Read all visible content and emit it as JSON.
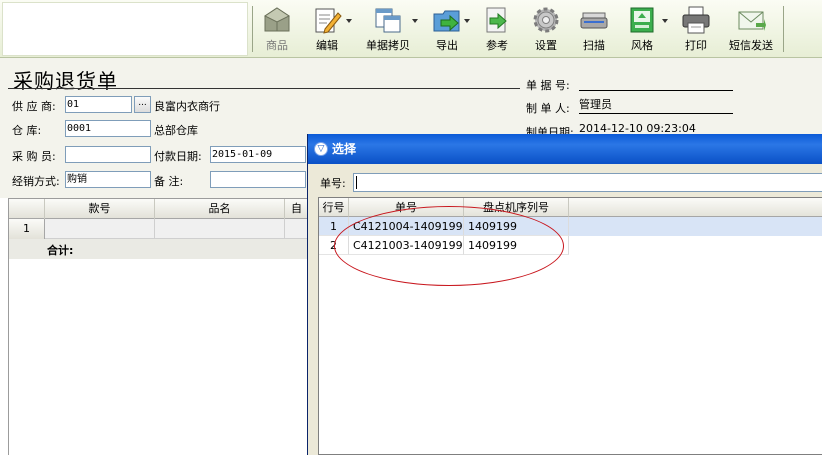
{
  "toolbar": {
    "buttons": [
      {
        "label": "商品",
        "icon": "goods-icon"
      },
      {
        "label": "编辑",
        "icon": "edit-icon"
      },
      {
        "label": "单据拷贝",
        "icon": "copy-doc-icon"
      },
      {
        "label": "导出",
        "icon": "export-icon"
      },
      {
        "label": "参考",
        "icon": "reference-icon"
      },
      {
        "label": "设置",
        "icon": "settings-gear-icon"
      },
      {
        "label": "扫描",
        "icon": "scanner-icon"
      },
      {
        "label": "风格",
        "icon": "style-icon"
      },
      {
        "label": "打印",
        "icon": "printer-icon"
      },
      {
        "label": "短信发送",
        "icon": "sms-envelope-icon"
      }
    ]
  },
  "form": {
    "title": "采购退货单",
    "supplier_label": "供 应 商:",
    "supplier_code": "01",
    "supplier_name": "良富内衣商行",
    "browse_label": "...",
    "warehouse_label": "仓    库:",
    "warehouse_code": "0001",
    "warehouse_name": "总部仓库",
    "purchaser_label": "采 购 员:",
    "purchaser_value": "",
    "payment_date_label": "付款日期:",
    "payment_date": "2015-01-09",
    "sales_mode_label": "经销方式:",
    "sales_mode": "购销",
    "remark_label": "备    注:",
    "remark_value": "",
    "doc_no_label": "单 据 号:",
    "doc_no": "",
    "maker_label": "制 单 人:",
    "maker": "管理员",
    "make_date_label": "制单日期:",
    "make_date": "2014-12-10 09:23:04"
  },
  "grid": {
    "columns": [
      "款号",
      "品名",
      "自"
    ],
    "rows": [
      {
        "num": "1"
      }
    ],
    "total_label": "合计:"
  },
  "dialog": {
    "title": "选择",
    "search_label": "单号:",
    "search_value": "",
    "columns": [
      "行号",
      "单号",
      "盘点机序列号"
    ],
    "rows": [
      {
        "num": "1",
        "doc_no": "C4121004-1409199",
        "serial": "1409199"
      },
      {
        "num": "2",
        "doc_no": "C4121003-1409199",
        "serial": "1409199"
      }
    ]
  },
  "colors": {
    "annotation": "#c8161d",
    "dialog_title": "#0b5ad7",
    "selected_row": "#d8e4f6"
  }
}
